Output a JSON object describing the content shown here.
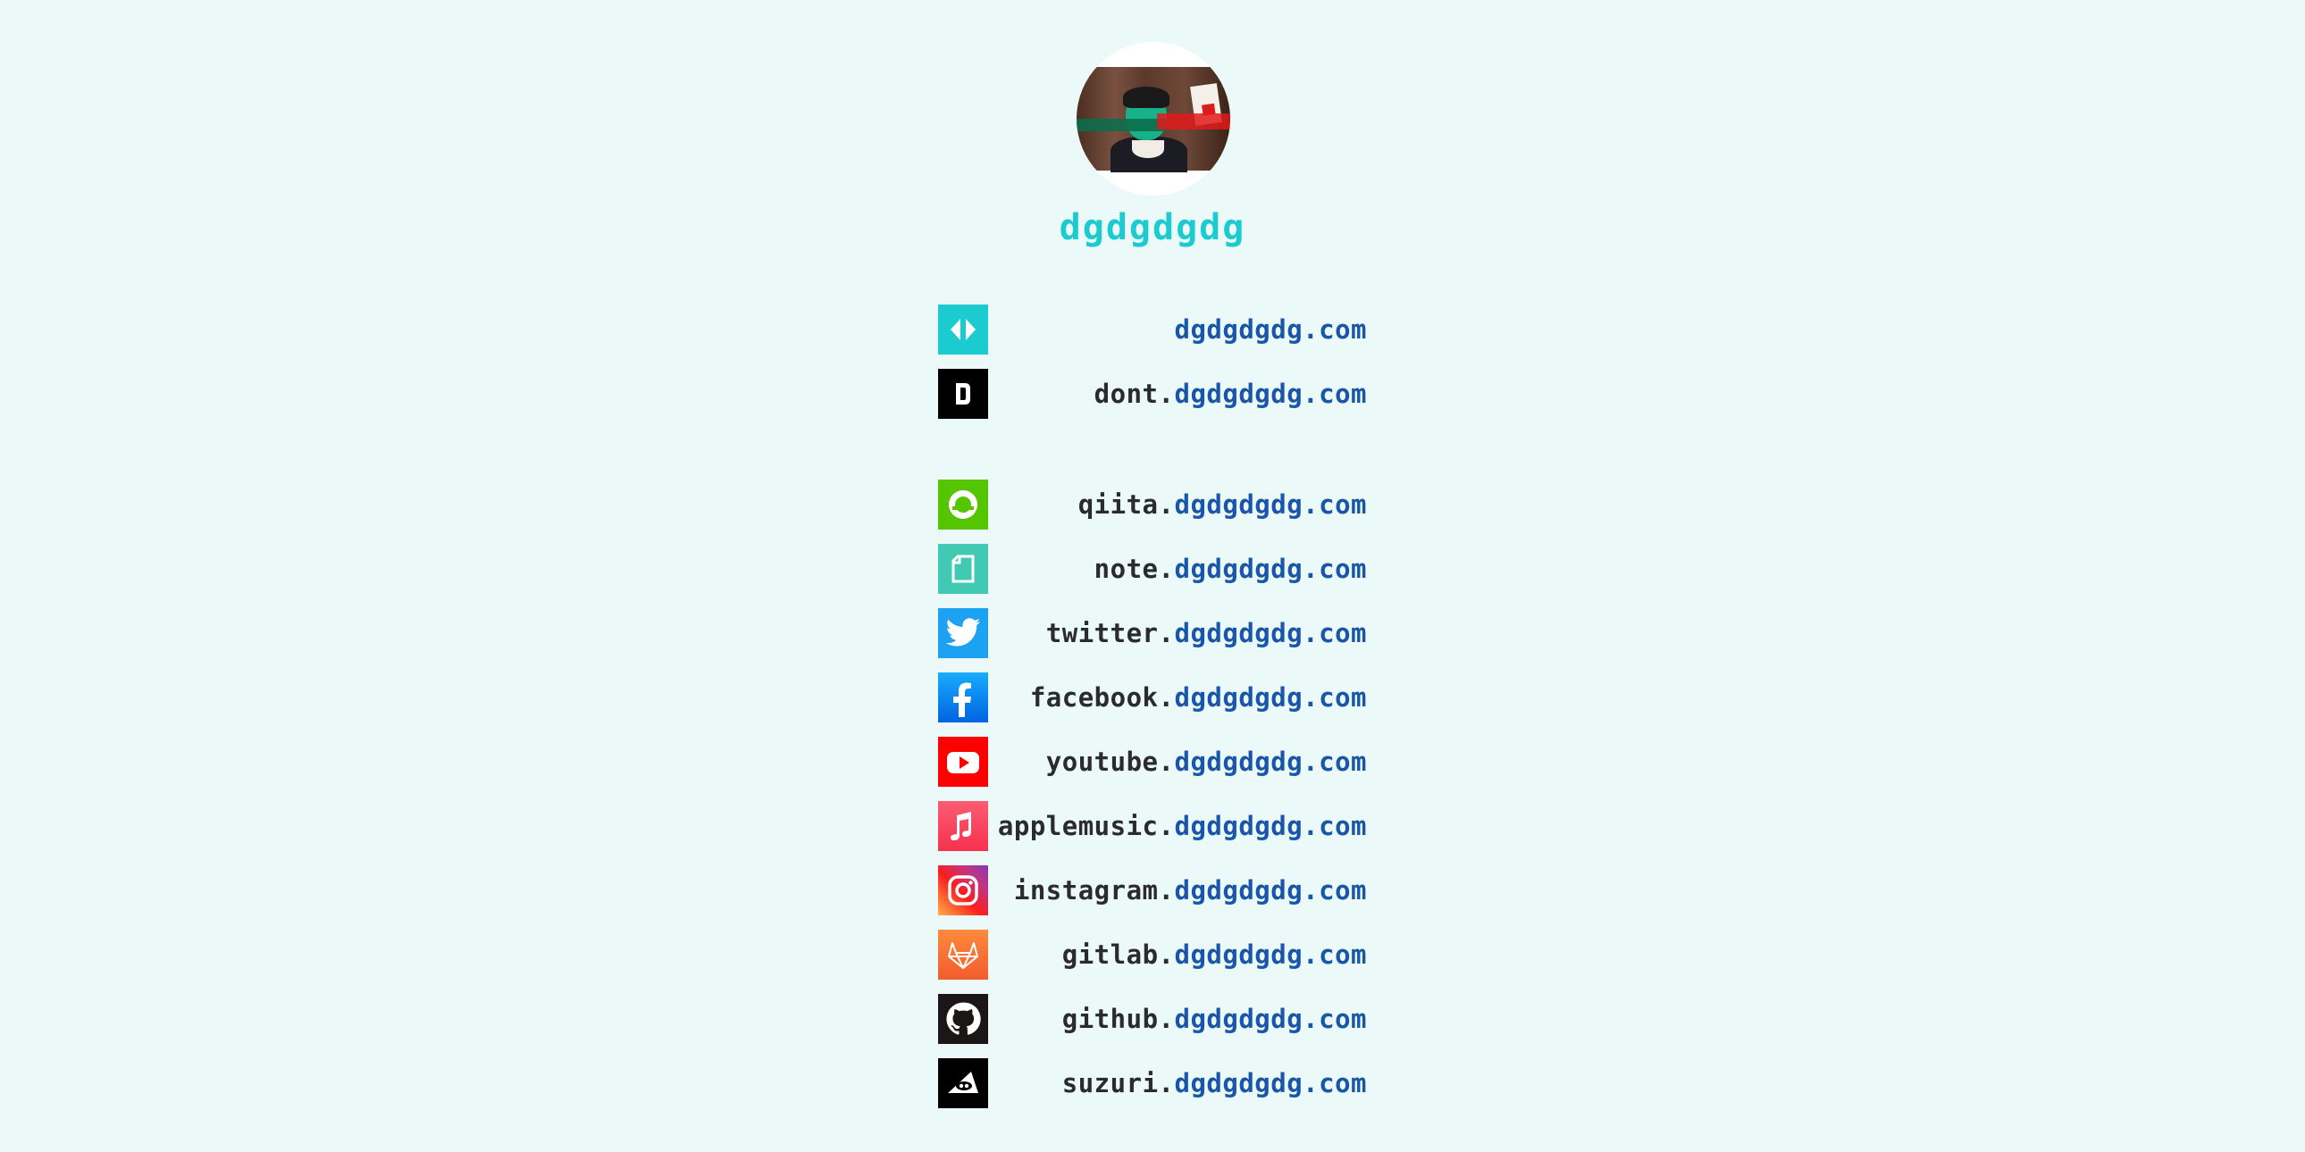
{
  "profile": {
    "site_title": "dgdgdgdg"
  },
  "links": [
    {
      "subdomain": "",
      "domain": "dgdgdgdg.com",
      "icon": "dgdgdgdg-logo-icon",
      "color": "#1ccbd0"
    },
    {
      "subdomain": "dont.",
      "domain": "dgdgdgdg.com",
      "icon": "dont-logo-icon",
      "color": "#000000"
    },
    {
      "subdomain": "qiita.",
      "domain": "dgdgdgdg.com",
      "icon": "qiita-icon",
      "color": "#55c500"
    },
    {
      "subdomain": "note.",
      "domain": "dgdgdgdg.com",
      "icon": "note-icon",
      "color": "#41c9b4"
    },
    {
      "subdomain": "twitter.",
      "domain": "dgdgdgdg.com",
      "icon": "twitter-icon",
      "color": "#1da1f2"
    },
    {
      "subdomain": "facebook.",
      "domain": "dgdgdgdg.com",
      "icon": "facebook-icon",
      "color": "#1877f2"
    },
    {
      "subdomain": "youtube.",
      "domain": "dgdgdgdg.com",
      "icon": "youtube-icon",
      "color": "#ff0000"
    },
    {
      "subdomain": "applemusic.",
      "domain": "dgdgdgdg.com",
      "icon": "apple-music-icon",
      "color": "#fa3c5a"
    },
    {
      "subdomain": "instagram.",
      "domain": "dgdgdgdg.com",
      "icon": "instagram-icon",
      "color": "#d6306e"
    },
    {
      "subdomain": "gitlab.",
      "domain": "dgdgdgdg.com",
      "icon": "gitlab-icon",
      "color": "#fc6d26"
    },
    {
      "subdomain": "github.",
      "domain": "dgdgdgdg.com",
      "icon": "github-icon",
      "color": "#181717"
    },
    {
      "subdomain": "suzuri.",
      "domain": "dgdgdgdg.com",
      "icon": "suzuri-icon",
      "color": "#000000"
    }
  ],
  "colors": {
    "background": "#ebfaf8",
    "title": "#1ccbd0",
    "domain_text": "#1a56a8",
    "subdomain_text": "#2b2b2b"
  }
}
